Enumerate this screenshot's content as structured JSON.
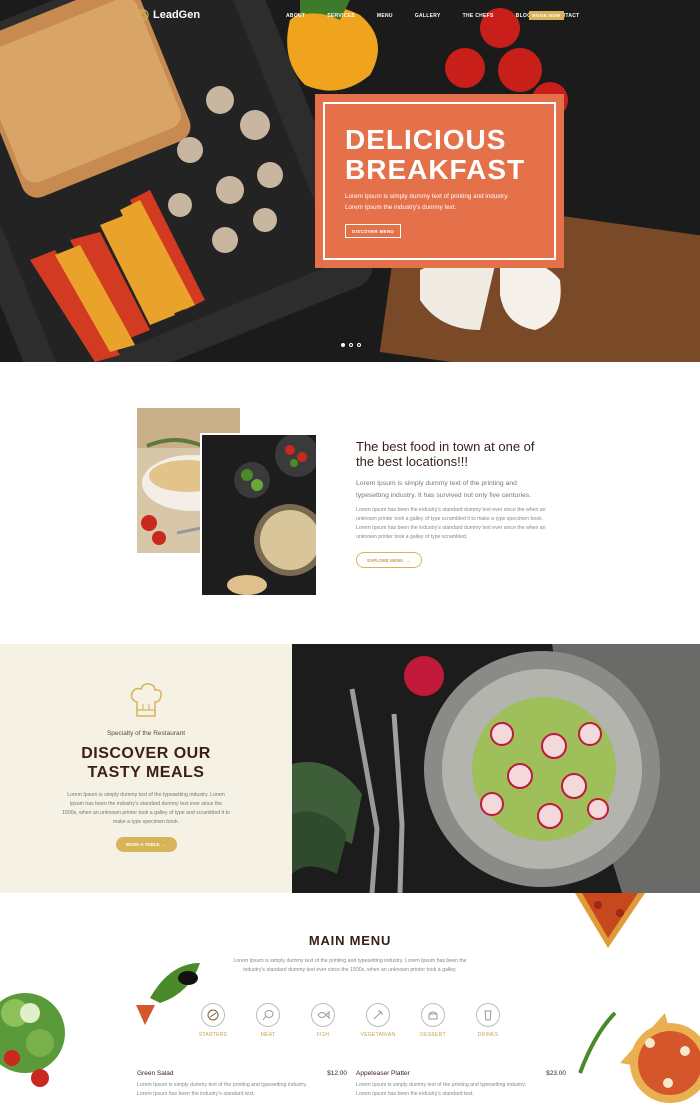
{
  "nav": {
    "brand": "LeadGen",
    "items": [
      "ABOUT",
      "SERVICES",
      "MENU",
      "GALLERY",
      "THE CHEFS",
      "BLOG",
      "CONTACT"
    ],
    "cta": "BOOK NOW"
  },
  "hero": {
    "title_line1": "DELICIOUS",
    "title_line2": "BREAKFAST",
    "text": "Lorem Ipsum is simply dummy text of printing and industry. Lorem Ipsum the industry's dummy text.",
    "button": "DISCOVER MENU",
    "slides": 3,
    "active_slide": 1
  },
  "about": {
    "title": "The best food in town at one of the best locations!!!",
    "lead": "Lorem Ipsum is simply dummy text of the printing and typesetting industry. It has survived not only five centuries.",
    "body": "Lorem Ipsum has been the industry's standard dummy text ever since the when an unknown printer took a galley of type scrambled it to make a type specimen book. Lorem Ipsum has been the industry's standard dummy text ever since the when an unknown printer took a galley of type scrambled.",
    "button": "EXPLORE MENU"
  },
  "special": {
    "subtitle": "Specialty of the Restaurant",
    "title_line1": "DISCOVER OUR",
    "title_line2": "TASTY MEALS",
    "text": "Lorem Ipsum is simply dummy text of the typesetting industry. Lorem Ipsum has been the industry's standard dummy text ever since the 1500s, when an unknown printer took a galley of type and scrambled it to make a type specimen book.",
    "button": "BOOK A TABLE"
  },
  "main_menu": {
    "title": "MAIN MENU",
    "text": "Lorem Ipsum is simply dummy text of the printing and typesetting industry. Lorem Ipsum has been the industry's standard dummy text ever since the 1500s, when an unknown printer took a galley.",
    "categories": [
      {
        "label": "STARTERS",
        "icon": "starters-icon"
      },
      {
        "label": "MEAT",
        "icon": "meat-icon"
      },
      {
        "label": "FISH",
        "icon": "fish-icon"
      },
      {
        "label": "VEGETARIAN",
        "icon": "vegetarian-icon"
      },
      {
        "label": "DESSERT",
        "icon": "dessert-icon"
      },
      {
        "label": "DRINKS",
        "icon": "drinks-icon"
      }
    ],
    "items": [
      {
        "name": "Green Salad",
        "price": "$12.00",
        "desc": "Lorem Ipsum is simply dummy text of the printing and typesetting industry. Lorem Ipsum has been the industry's standard text."
      },
      {
        "name": "Appeteaser Platter",
        "price": "$23.00",
        "desc": "Lorem Ipsum is simply dummy text of the printing and typesetting industry. Lorem Ipsum has been the industry's standard text."
      }
    ]
  },
  "colors": {
    "accent": "#d8b35a",
    "hero_box": "#e5714a",
    "heading": "#3a1e18",
    "cream": "#f5f1e4"
  }
}
